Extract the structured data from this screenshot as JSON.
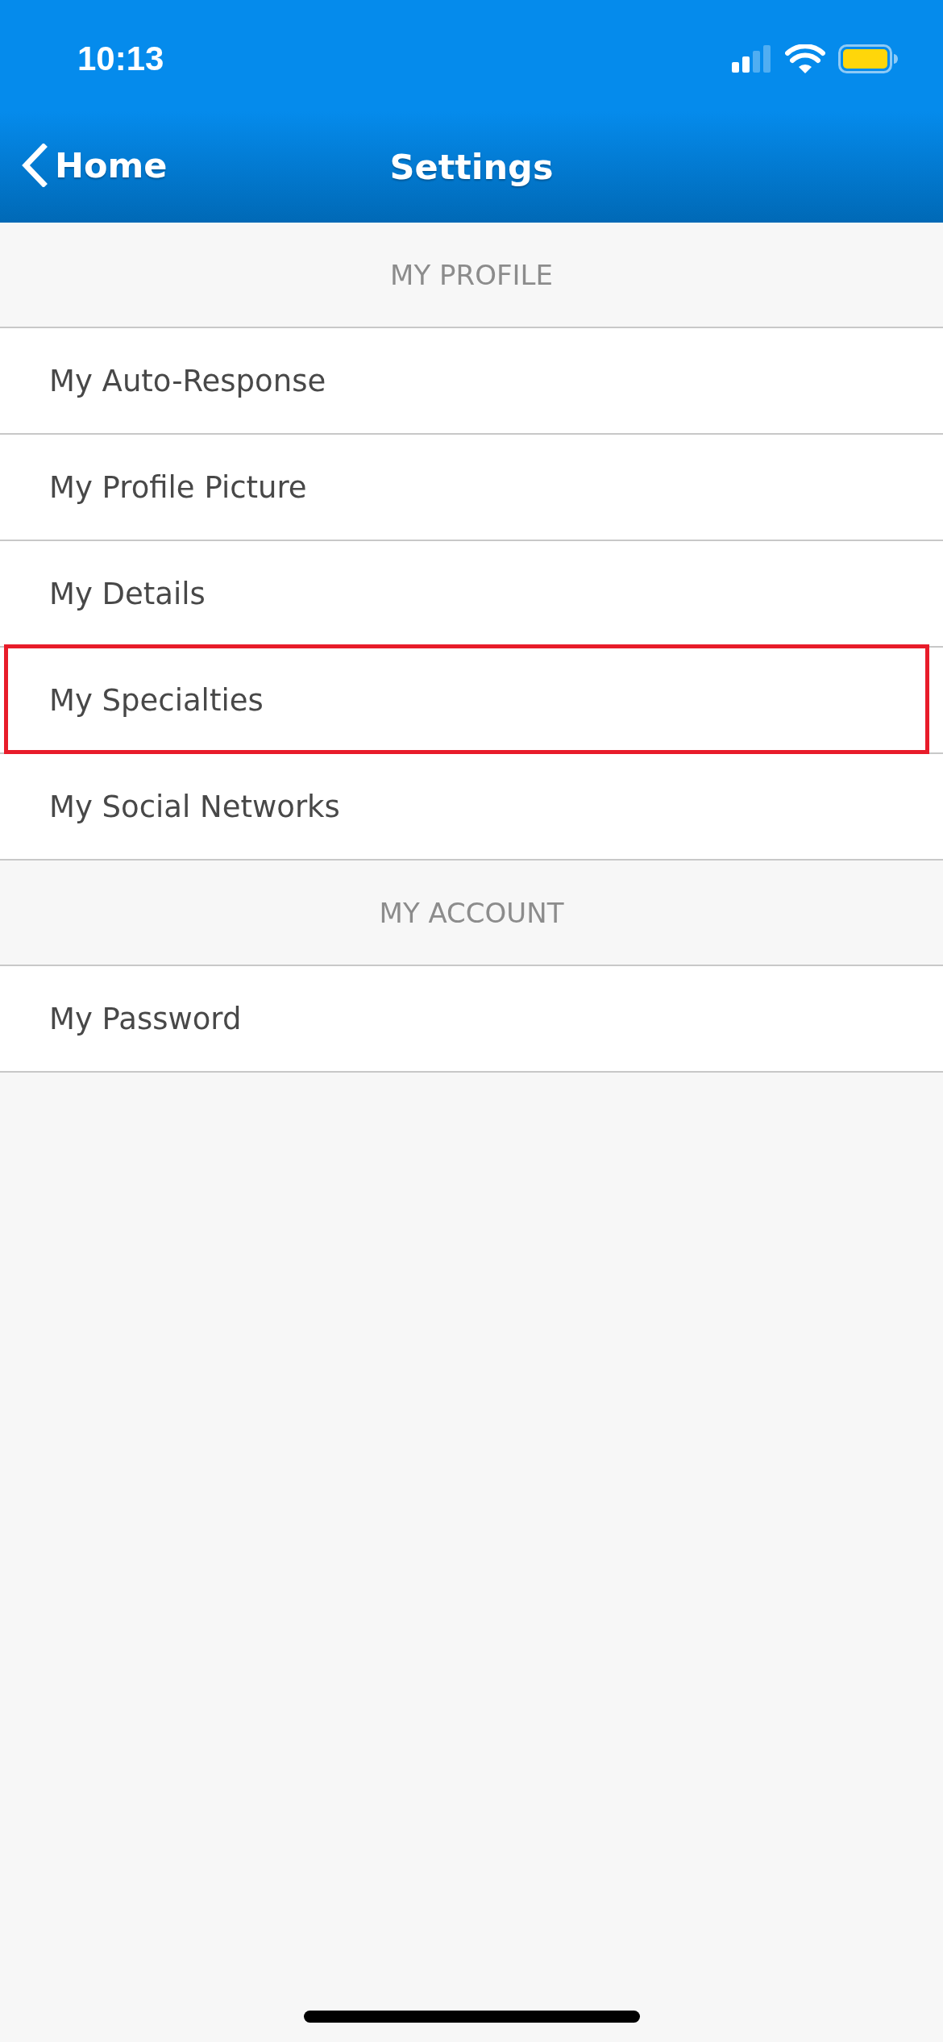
{
  "status_bar": {
    "time": "10:13"
  },
  "nav_bar": {
    "back_label": "Home",
    "title": "Settings"
  },
  "sections": [
    {
      "title": "MY PROFILE",
      "items": [
        {
          "label": "My Auto-Response",
          "highlighted": false
        },
        {
          "label": "My Profile Picture",
          "highlighted": false
        },
        {
          "label": "My Details",
          "highlighted": false
        },
        {
          "label": "My Specialties",
          "highlighted": true
        },
        {
          "label": "My Social Networks",
          "highlighted": false
        }
      ]
    },
    {
      "title": "MY ACCOUNT",
      "items": [
        {
          "label": "My Password",
          "highlighted": false
        }
      ]
    }
  ]
}
